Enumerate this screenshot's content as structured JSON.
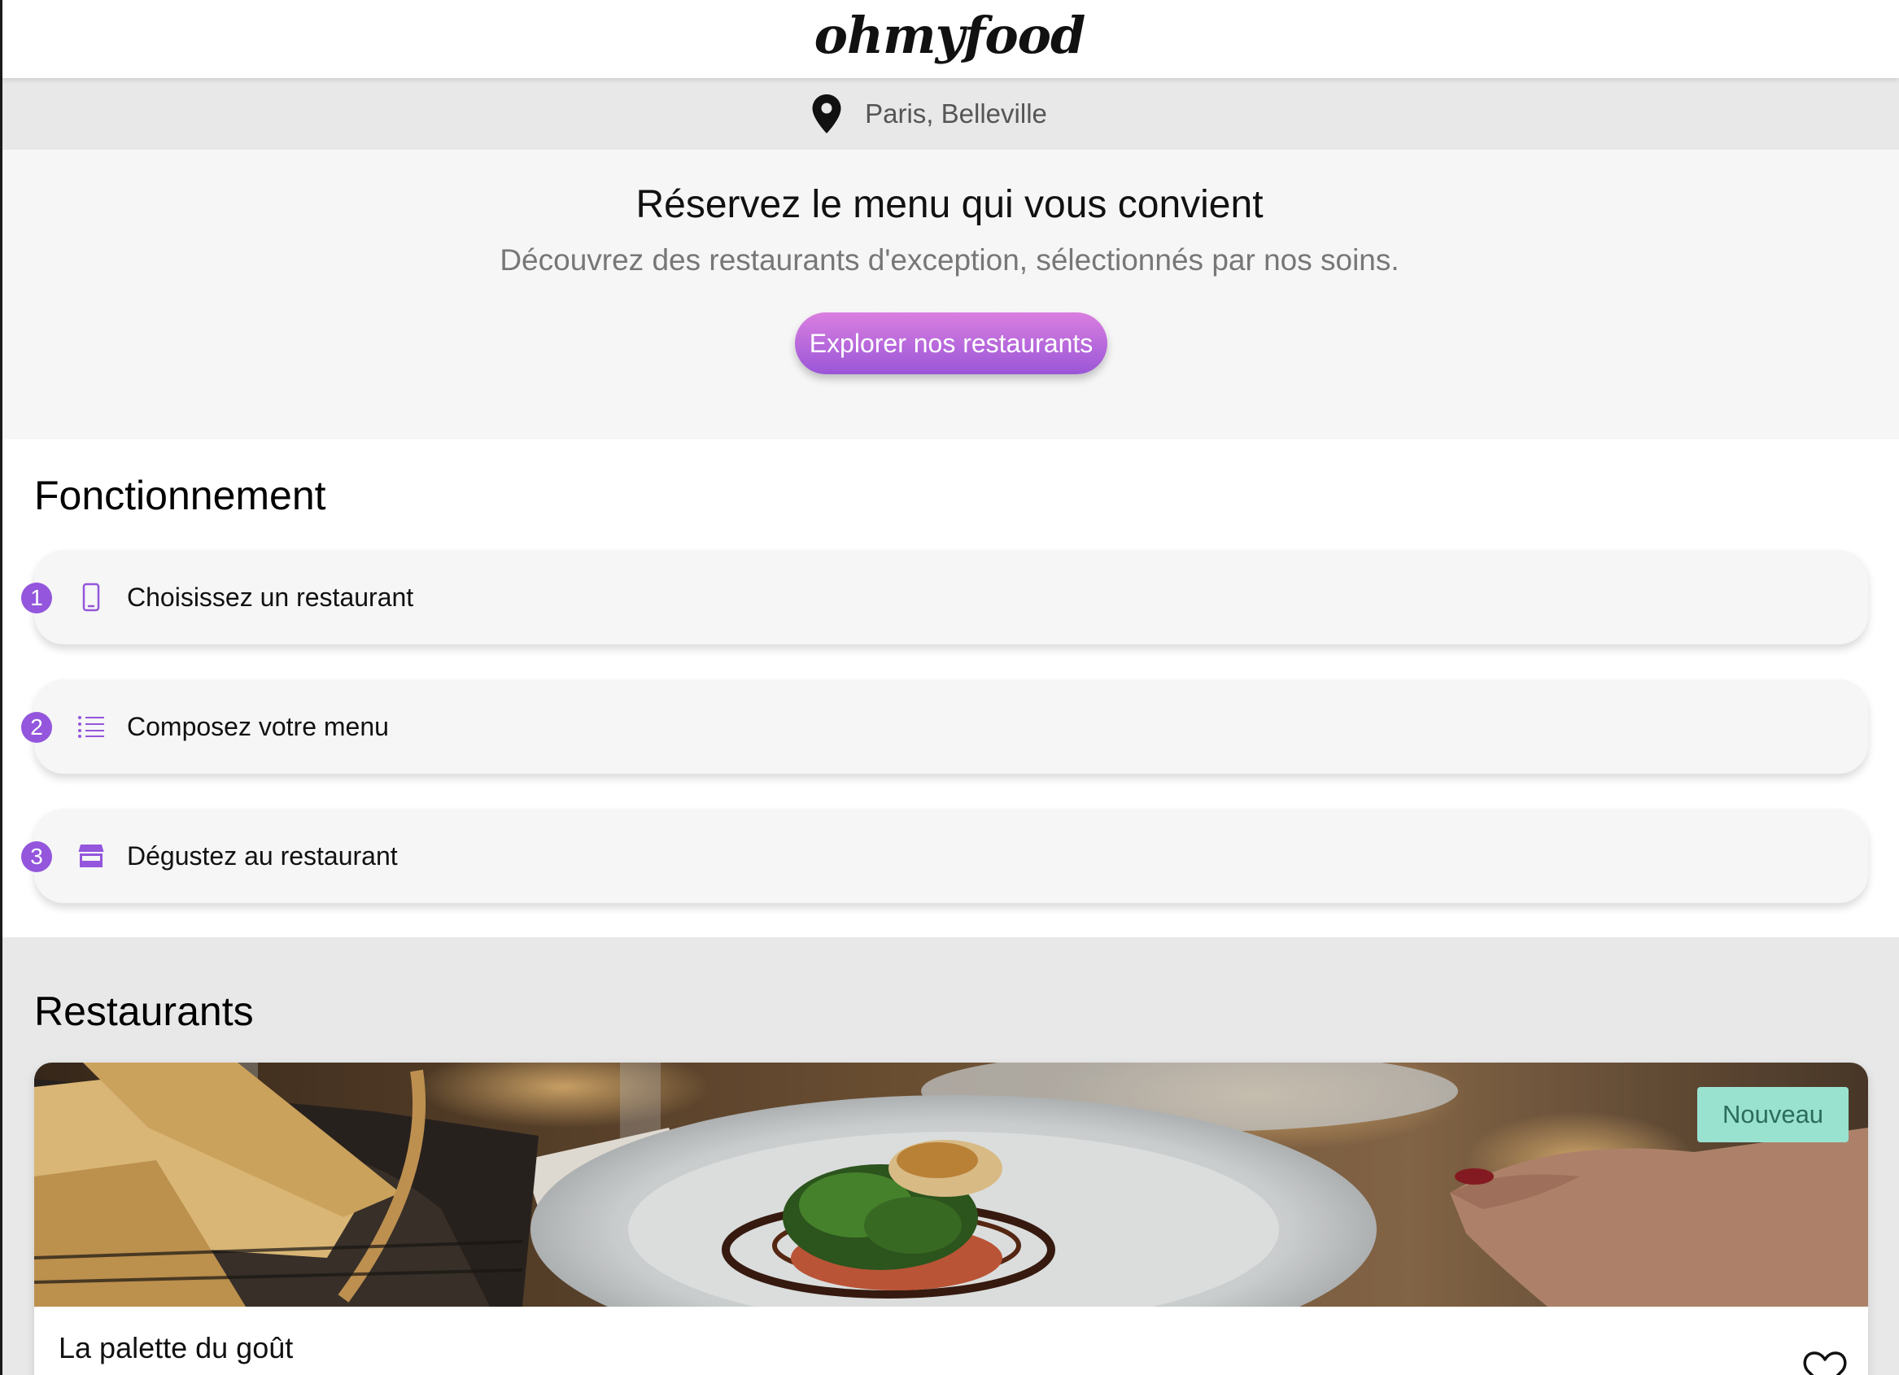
{
  "header": {
    "logo": "ohmyfood"
  },
  "location": {
    "icon": "map-pin-icon",
    "text": "Paris, Belleville"
  },
  "hero": {
    "title": "Réservez le menu qui vous convient",
    "subtitle": "Découvrez des restaurants d'exception, sélectionnés par nos soins.",
    "cta_label": "Explorer nos restaurants"
  },
  "how": {
    "title": "Fonctionnement",
    "steps": [
      {
        "number": "1",
        "icon": "mobile-phone-icon",
        "label": "Choisissez un restaurant"
      },
      {
        "number": "2",
        "icon": "list-icon",
        "label": "Composez votre menu"
      },
      {
        "number": "3",
        "icon": "store-icon",
        "label": "Dégustez au restaurant"
      }
    ]
  },
  "restaurants": {
    "title": "Restaurants",
    "items": [
      {
        "name": "La palette du goût",
        "badge": "Nouveau",
        "favorite_icon": "heart-outline-icon"
      }
    ]
  },
  "colors": {
    "accent": "#9356dc",
    "gradient_start": "#da7fe0",
    "gradient_end": "#9a56d7",
    "badge_bg": "#99e2d0",
    "badge_text": "#2b6c5c"
  }
}
